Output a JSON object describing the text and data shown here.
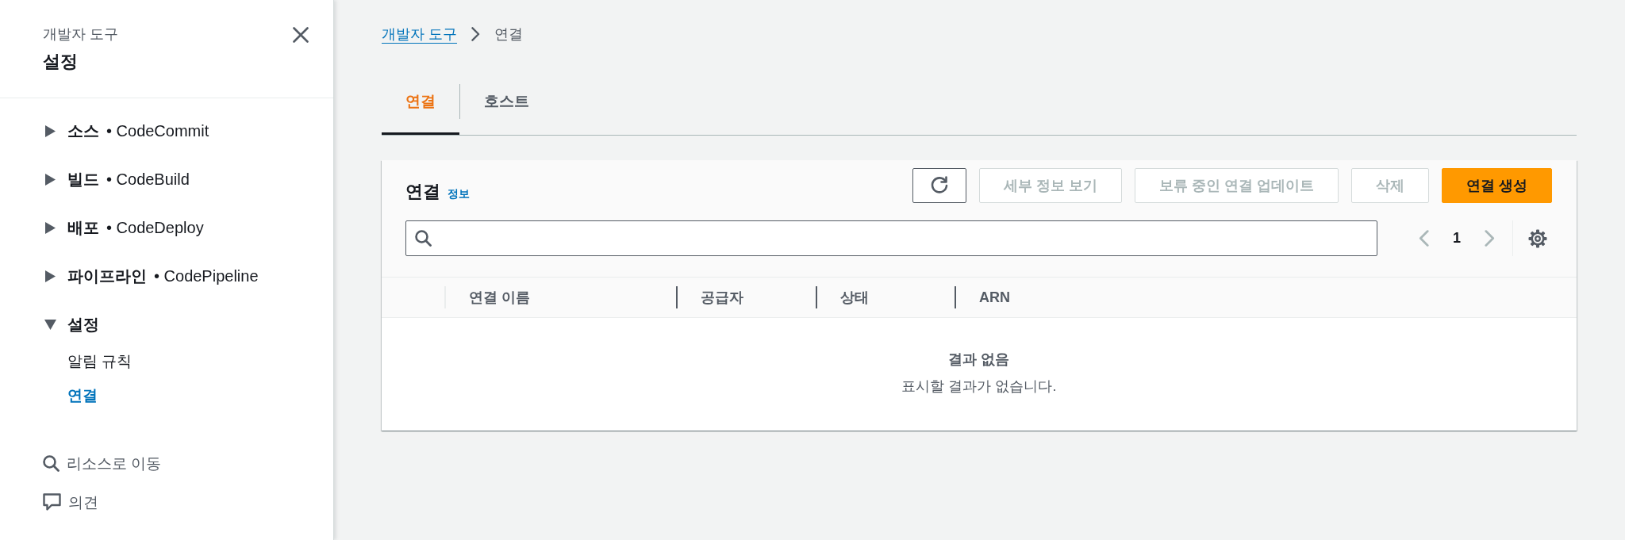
{
  "sidebar": {
    "subtitle": "개발자 도구",
    "title": "설정",
    "sections": [
      {
        "category": "소스",
        "service": "• CodeCommit",
        "expanded": false
      },
      {
        "category": "빌드",
        "service": "• CodeBuild",
        "expanded": false
      },
      {
        "category": "배포",
        "service": "• CodeDeploy",
        "expanded": false
      },
      {
        "category": "파이프라인",
        "service": "• CodePipeline",
        "expanded": false
      },
      {
        "category": "설정",
        "expanded": true,
        "children": [
          {
            "label": "알림 규칙",
            "selected": false
          },
          {
            "label": "연결",
            "selected": true
          }
        ]
      }
    ],
    "footer_links": [
      {
        "kind": "search",
        "label": "리소스로 이동"
      },
      {
        "kind": "feedback",
        "label": "의견"
      }
    ]
  },
  "breadcrumb": [
    {
      "kind": "link",
      "label": "개발자 도구"
    },
    {
      "kind": "current",
      "label": "연결"
    }
  ],
  "tabs": [
    {
      "label": "연결",
      "selected": true
    },
    {
      "label": "호스트",
      "selected": false
    }
  ],
  "panel": {
    "title": "연결",
    "info_link": "정보",
    "toolbar": [
      {
        "kind": "refresh",
        "disabled": false
      },
      {
        "kind": "normal",
        "label": "세부 정보 보기",
        "disabled": true
      },
      {
        "kind": "normal",
        "label": "보류 중인 연결 업데이트",
        "disabled": true
      },
      {
        "kind": "normal",
        "label": "삭제",
        "disabled": true
      },
      {
        "kind": "primary",
        "label": "연결 생성",
        "disabled": false
      }
    ],
    "pagination": {
      "page": "1"
    },
    "table": {
      "columns": [
        "연결 이름",
        "공급자",
        "상태",
        "ARN"
      ],
      "empty_state": {
        "title": "결과 없음",
        "message": "표시할 결과가 없습니다."
      }
    }
  }
}
